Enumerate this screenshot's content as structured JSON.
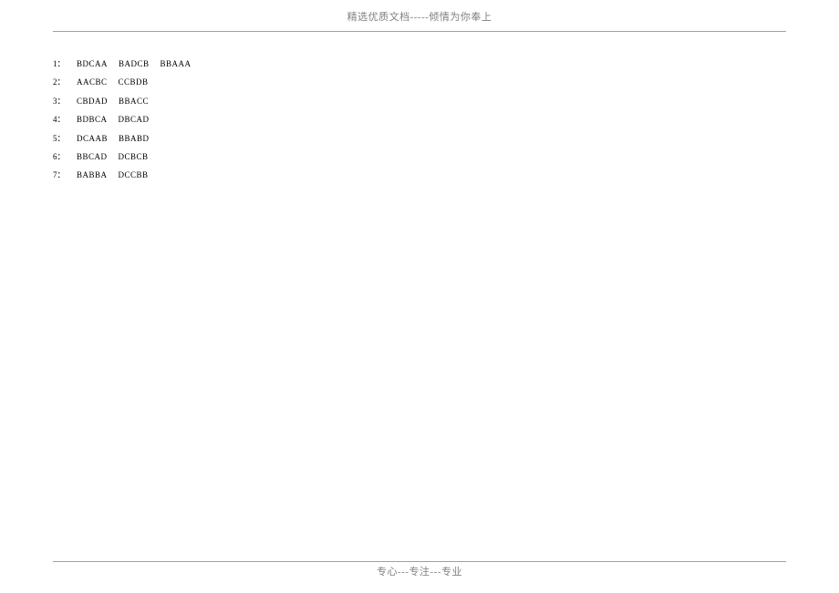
{
  "header_text": "精选优质文档-----倾情为你奉上",
  "footer_text": "专心---专注---专业",
  "rows": [
    {
      "num": "1：",
      "g1": "BDCAA",
      "g2": "BADCB",
      "g3": "BBAAA"
    },
    {
      "num": "2：",
      "g1": "AACBC",
      "g2": "CCBDB",
      "g3": ""
    },
    {
      "num": "3：",
      "g1": "CBDAD",
      "g2": "BBACC",
      "g3": ""
    },
    {
      "num": "4：",
      "g1": "BDBCA",
      "g2": "DBCAD",
      "g3": ""
    },
    {
      "num": "5：",
      "g1": "DCAAB",
      "g2": "BBABD",
      "g3": ""
    },
    {
      "num": "6：",
      "g1": "BBCAD",
      "g2": "DCBCB",
      "g3": ""
    },
    {
      "num": "7：",
      "g1": "BABBA",
      "g2": "DCCBB",
      "g3": ""
    }
  ]
}
